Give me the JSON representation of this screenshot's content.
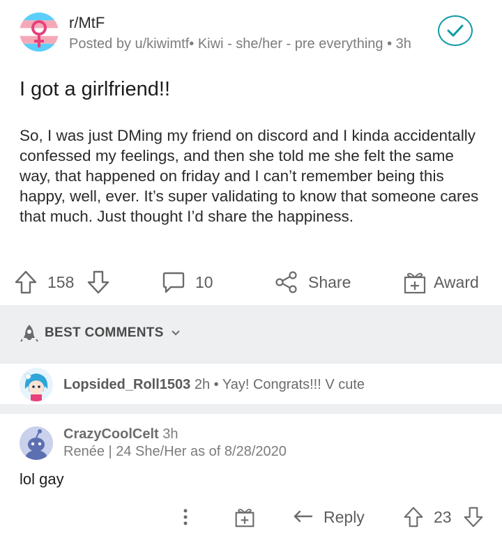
{
  "post": {
    "subreddit": "r/MtF",
    "meta": "Posted by u/kiwimtf• Kiwi - she/her - pre everything • 3h",
    "title": "I got a girlfriend!!",
    "body": "So, I was just DMing my friend on discord and I kinda accidentally confessed my feelings, and then she told me she felt the same way, that happened on friday and I can’t remember being this happy, well, ever. It’s super validating to know that someone cares that much. Just thought I’d share the happiness.",
    "upvotes": "158",
    "comments": "10",
    "share_label": "Share",
    "award_label": "Award",
    "icons": {
      "subreddit": "transgender-flag-symbol-icon",
      "joined": "check-circle-icon",
      "upvote": "arrow-up-icon",
      "downvote": "arrow-down-icon",
      "comment": "speech-bubble-icon",
      "share": "share-icon",
      "award": "gift-icon"
    }
  },
  "comments_header": {
    "sort_label": "BEST COMMENTS",
    "icons": {
      "sort": "rocket-icon",
      "dropdown": "chevron-down-icon"
    }
  },
  "comments": [
    {
      "username": "Lopsided_Roll1503",
      "age": "2h",
      "preview": "• Yay! Congrats!!! V cute",
      "collapsed": true
    },
    {
      "username": "CrazyCoolCelt",
      "age": "3h",
      "flair": "Renée | 24 She/Her as of 8/28/2020",
      "body": "lol gay",
      "reply_label": "Reply",
      "score": "23",
      "icons": {
        "more": "more-vertical-icon",
        "award": "gift-icon",
        "reply": "reply-arrow-icon",
        "upvote": "arrow-up-icon",
        "downvote": "arrow-down-icon"
      }
    }
  ],
  "colors": {
    "accent": "#0e9aa7",
    "trans_blue": "#5bcefa",
    "trans_pink": "#f5a9b8",
    "symbol_pink": "#e8407a",
    "band": "#edeff1"
  }
}
